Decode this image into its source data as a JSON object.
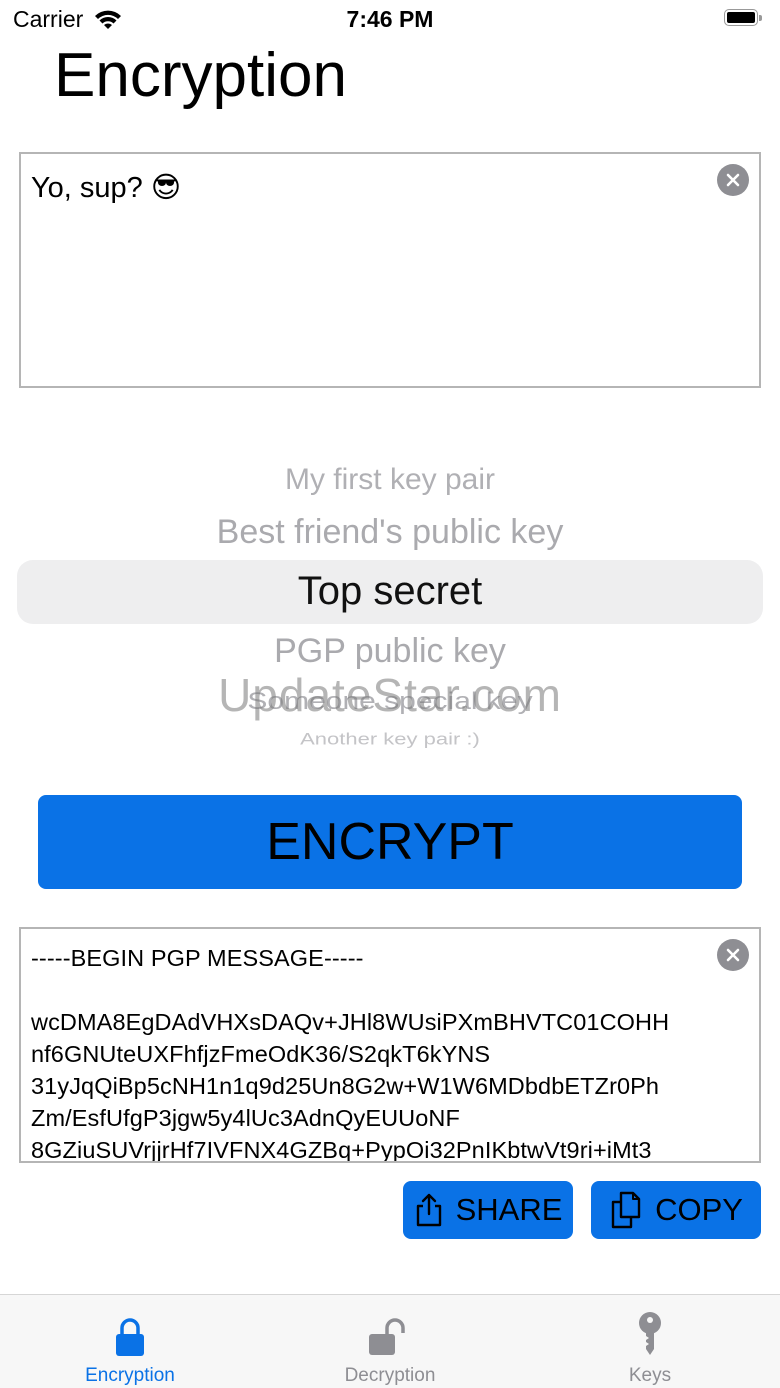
{
  "status_bar": {
    "carrier": "Carrier",
    "time": "7:46 PM"
  },
  "page": {
    "title": "Encryption"
  },
  "input": {
    "text": "Yo, sup? 😎"
  },
  "picker": {
    "items": [
      "My first key pair",
      "Best friend's public key",
      "Top secret",
      "PGP public key",
      "Someone special key",
      "Another key pair :)"
    ],
    "selected": "Top secret"
  },
  "watermark": "UpdateStar.com",
  "encrypt_button": {
    "label": "ENCRYPT"
  },
  "output": {
    "lines": [
      "-----BEGIN PGP MESSAGE-----",
      "",
      "wcDMA8EgDAdVHXsDAQv+JHl8WUsiPXmBHVTC01COHH",
      "nf6GNUteUXFhfjzFmeOdK36/S2qkT6kYNS",
      "31yJqQiBp5cNH1n1q9d25Un8G2w+W1W6MDbdbETZr0Ph",
      "Zm/EsfUfgP3jgw5y4lUc3AdnQyEUUoNF",
      "8GZiuSUVrjjrHf7IVFNX4GZBq+PypOi32PnIKbtwVt9ri+iMt3"
    ]
  },
  "actions": {
    "share_label": "SHARE",
    "copy_label": "COPY"
  },
  "tabs": [
    {
      "label": "Encryption",
      "active": true
    },
    {
      "label": "Decryption",
      "active": false
    },
    {
      "label": "Keys",
      "active": false
    }
  ],
  "colors": {
    "accent": "#0a72e6",
    "tab_inactive": "#8e8e93",
    "border": "#b5b5b5"
  }
}
